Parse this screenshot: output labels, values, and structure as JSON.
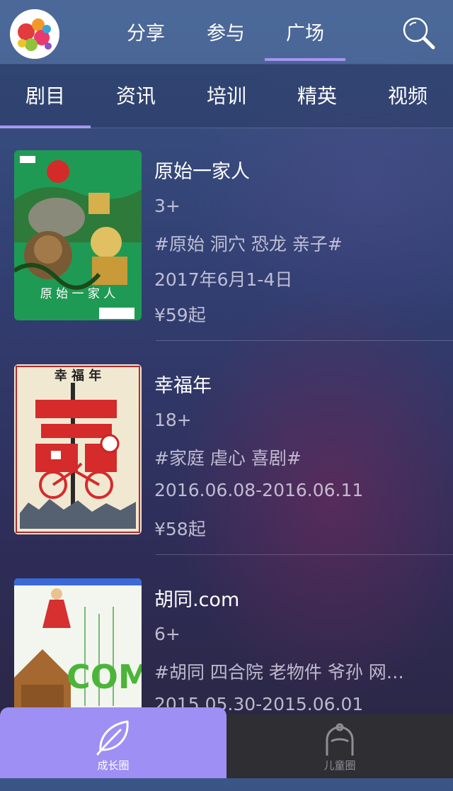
{
  "header": {
    "tabs": [
      {
        "label": "分享"
      },
      {
        "label": "参与"
      },
      {
        "label": "广场",
        "active": true
      }
    ]
  },
  "categories": [
    {
      "label": "剧目",
      "active": true
    },
    {
      "label": "资讯"
    },
    {
      "label": "培训"
    },
    {
      "label": "精英"
    },
    {
      "label": "视频"
    }
  ],
  "plays": [
    {
      "title": "原始一家人",
      "age": "3+",
      "tags": "#原始 洞穴 恐龙 亲子#",
      "date": "2017年6月1-4日",
      "price": "¥59起",
      "poster_text": "原 始 一 家 人"
    },
    {
      "title": "幸福年",
      "age": "18+",
      "tags": "#家庭 虐心 喜剧#",
      "date": "2016.06.08-2016.06.11",
      "price": "¥58起",
      "poster_text": "幸 福 年"
    },
    {
      "title": "胡同.com",
      "age": "6+",
      "tags": "#胡同 四合院 老物件 爷孙 网…",
      "date": "2015.05.30-2015.06.01",
      "price": "",
      "poster_text": "COM"
    }
  ],
  "bottom_nav": [
    {
      "label": "成长圈",
      "icon": "leaf-icon",
      "active": true
    },
    {
      "label": "儿童圈",
      "icon": "child-icon"
    }
  ],
  "colors": {
    "accent": "#9e8ff4",
    "indicator": "#a394f0",
    "bottom_bar": "#2e2e33"
  }
}
